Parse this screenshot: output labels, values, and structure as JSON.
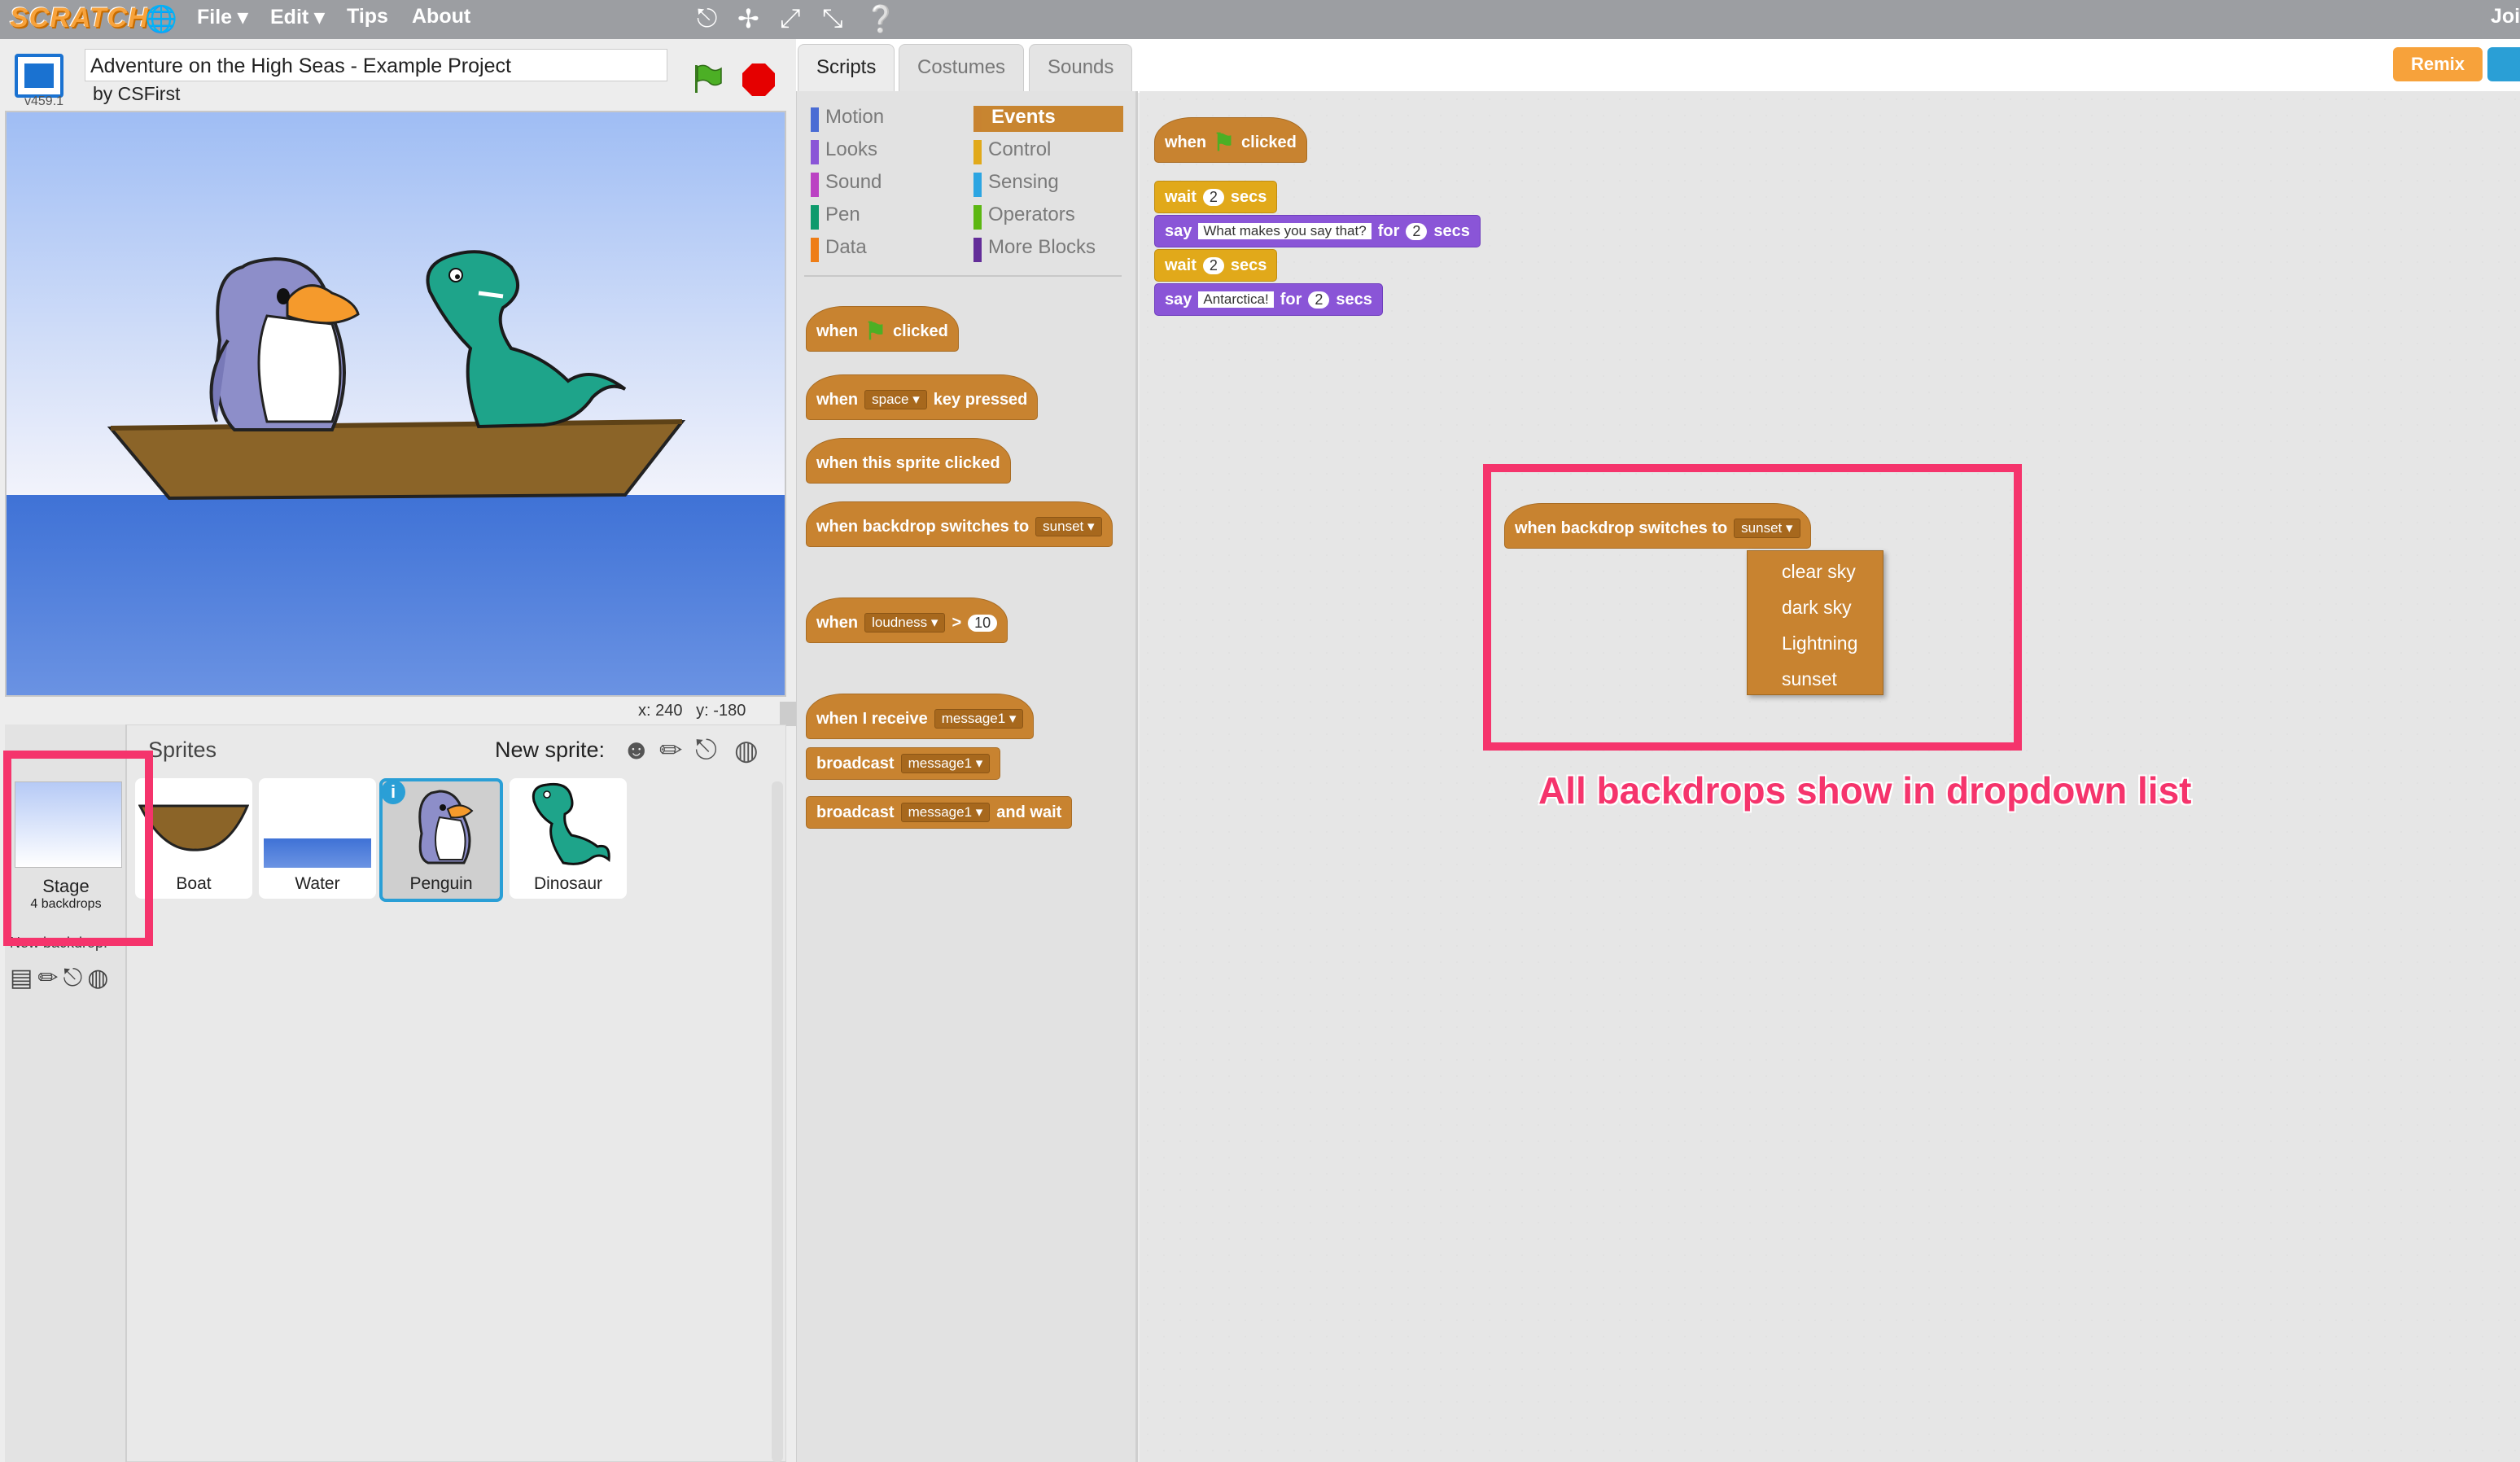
{
  "app": {
    "logo_text": "SCRATCH",
    "menu": {
      "file": "File ▾",
      "edit": "Edit ▾",
      "tips": "Tips",
      "about": "About"
    },
    "join_text": "Joi",
    "version": "v459.1"
  },
  "project": {
    "title": "Adventure on the High Seas - Example Project",
    "author": "by CSFirst"
  },
  "stage_info": {
    "x_label": "x:",
    "x_value": "240",
    "y_label": "y:",
    "y_value": "-180"
  },
  "sprites_pane": {
    "label": "Sprites",
    "new_sprite_label": "New sprite:",
    "stage_label": "Stage",
    "stage_sub": "4 backdrops",
    "new_backdrop_label": "New backdrop:",
    "sprites": [
      {
        "name": "Boat"
      },
      {
        "name": "Water"
      },
      {
        "name": "Penguin",
        "selected": true
      },
      {
        "name": "Dinosaur"
      }
    ]
  },
  "tabs": [
    "Scripts",
    "Costumes",
    "Sounds"
  ],
  "categories": {
    "left": [
      {
        "label": "Motion",
        "color": "#4a6cd4"
      },
      {
        "label": "Looks",
        "color": "#8a55d7"
      },
      {
        "label": "Sound",
        "color": "#bb42c3"
      },
      {
        "label": "Pen",
        "color": "#0e9a6c"
      },
      {
        "label": "Data",
        "color": "#ee7d16"
      }
    ],
    "right": [
      {
        "label": "Events",
        "color": "#c88330",
        "selected": true
      },
      {
        "label": "Control",
        "color": "#e1a91a"
      },
      {
        "label": "Sensing",
        "color": "#2ca5e2"
      },
      {
        "label": "Operators",
        "color": "#5cb712"
      },
      {
        "label": "More Blocks",
        "color": "#632d99"
      }
    ]
  },
  "palette_blocks": {
    "flag_hat": {
      "when": "when",
      "clicked": "clicked"
    },
    "key_hat": {
      "when": "when",
      "key": "space",
      "pressed": "key  pressed"
    },
    "sprite_clicked": "when  this  sprite  clicked",
    "backdrop_hat": {
      "text": "when  backdrop  switches  to",
      "value": "sunset"
    },
    "loudness_hat": {
      "when": "when",
      "sensor": "loudness",
      "op": ">",
      "value": "10"
    },
    "receive_hat": {
      "text": "when  I  receive",
      "value": "message1"
    },
    "broadcast": {
      "text": "broadcast",
      "value": "message1"
    },
    "broadcast_wait": {
      "text": "broadcast",
      "value": "message1",
      "tail": "and  wait"
    }
  },
  "script": {
    "hat": {
      "when": "when",
      "clicked": "clicked"
    },
    "wait1": {
      "label": "wait",
      "value": "2",
      "unit": "secs"
    },
    "say1": {
      "label": "say",
      "text": "What makes you say that?",
      "for": "for",
      "value": "2",
      "unit": "secs"
    },
    "wait2": {
      "label": "wait",
      "value": "2",
      "unit": "secs"
    },
    "say2": {
      "label": "say",
      "text": "Antarctica!",
      "for": "for",
      "value": "2",
      "unit": "secs"
    }
  },
  "backdrop_script": {
    "text": "when  backdrop  switches  to",
    "value": "sunset",
    "options": [
      "clear sky",
      "dark sky",
      "Lightning",
      "sunset"
    ]
  },
  "buttons": {
    "remix": "Remix"
  },
  "annotation": "All backdrops show in dropdown list",
  "colors": {
    "accent_highlight": "#f5346c",
    "events": "#c88330",
    "control": "#e1a91a",
    "looks": "#8a55d7",
    "selected_border": "#2a9fd6",
    "remix": "#f7a23b"
  }
}
